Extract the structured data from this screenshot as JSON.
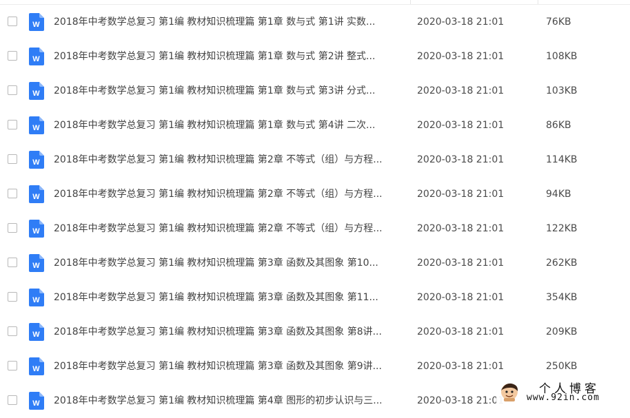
{
  "colors": {
    "word_icon": "#2f7df6",
    "text": "#424242"
  },
  "icons": {
    "file_type": "word-document-icon"
  },
  "files": [
    {
      "name": "2018年中考数学总复习 第1编 教材知识梳理篇 第1章 数与式 第1讲 实数...",
      "date": "2020-03-18 21:01",
      "size": "76KB"
    },
    {
      "name": "2018年中考数学总复习 第1编 教材知识梳理篇 第1章 数与式 第2讲 整式...",
      "date": "2020-03-18 21:01",
      "size": "108KB"
    },
    {
      "name": "2018年中考数学总复习 第1编 教材知识梳理篇 第1章 数与式 第3讲 分式...",
      "date": "2020-03-18 21:01",
      "size": "103KB"
    },
    {
      "name": "2018年中考数学总复习 第1编 教材知识梳理篇 第1章 数与式 第4讲 二次...",
      "date": "2020-03-18 21:01",
      "size": "86KB"
    },
    {
      "name": "2018年中考数学总复习 第1编 教材知识梳理篇 第2章 不等式（组）与方程...",
      "date": "2020-03-18 21:01",
      "size": "114KB"
    },
    {
      "name": "2018年中考数学总复习 第1编 教材知识梳理篇 第2章 不等式（组）与方程...",
      "date": "2020-03-18 21:01",
      "size": "94KB"
    },
    {
      "name": "2018年中考数学总复习 第1编 教材知识梳理篇 第2章 不等式（组）与方程...",
      "date": "2020-03-18 21:01",
      "size": "122KB"
    },
    {
      "name": "2018年中考数学总复习 第1编 教材知识梳理篇 第3章 函数及其图象 第10...",
      "date": "2020-03-18 21:01",
      "size": "262KB"
    },
    {
      "name": "2018年中考数学总复习 第1编 教材知识梳理篇 第3章 函数及其图象 第11...",
      "date": "2020-03-18 21:01",
      "size": "354KB"
    },
    {
      "name": "2018年中考数学总复习 第1编 教材知识梳理篇 第3章 函数及其图象 第8讲...",
      "date": "2020-03-18 21:01",
      "size": "209KB"
    },
    {
      "name": "2018年中考数学总复习 第1编 教材知识梳理篇 第3章 函数及其图象 第9讲...",
      "date": "2020-03-18 21:01",
      "size": "250KB"
    },
    {
      "name": "2018年中考数学总复习 第1编 教材知识梳理篇 第4章 图形的初步认识与三...",
      "date": "2020-03-18 21:01",
      "size": ""
    }
  ],
  "watermark": {
    "title": "个人博客",
    "url": "www.92in.com"
  }
}
